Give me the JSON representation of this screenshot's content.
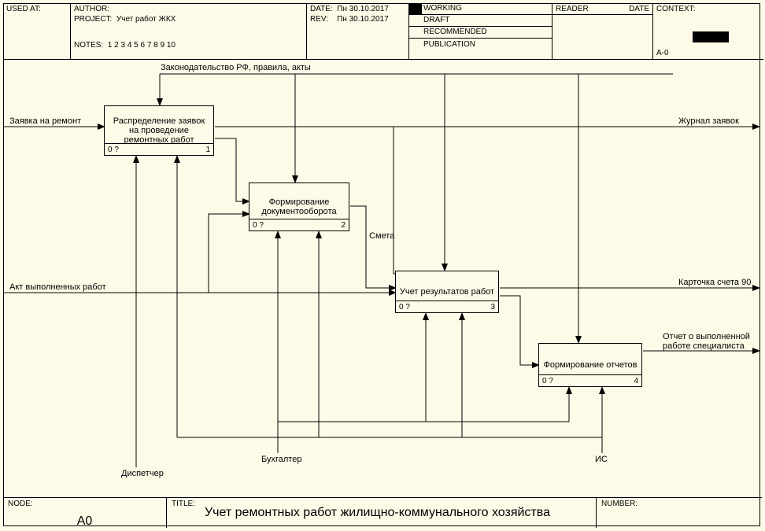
{
  "header": {
    "used_at": "USED AT:",
    "author_label": "AUTHOR:",
    "project_label": "PROJECT:",
    "project_value": "Учет работ ЖКХ",
    "notes_label": "NOTES:",
    "notes_value": "1  2  3  4  5  6  7  8  9  10",
    "date_label": "DATE:",
    "date_value": "Пн 30.10.2017",
    "rev_label": "REV:",
    "rev_value": "Пн 30.10.2017",
    "status": {
      "working": "WORKING",
      "draft": "DRAFT",
      "recommended": "RECOMMENDED",
      "publication": "PUBLICATION"
    },
    "reader_label": "READER",
    "reader_date": "DATE",
    "context_label": "CONTEXT:",
    "context_code": "A-0"
  },
  "nodes": {
    "n1": {
      "title": "Распределение заявок на проведение ремонтных работ",
      "left": "0 ?",
      "right": "1"
    },
    "n2": {
      "title": "Формирование документооборота",
      "left": "0 ?",
      "right": "2"
    },
    "n3": {
      "title": "Учет результатов работ",
      "left": "0 ?",
      "right": "3"
    },
    "n4": {
      "title": "Формирование отчетов",
      "left": "0 ?",
      "right": "4"
    }
  },
  "labels": {
    "input1": "Заявка на ремонт",
    "input2": "Акт выполненных работ",
    "control1": "Законодательство РФ, правила, акты",
    "mech1": "Диспетчер",
    "mech2": "Бухгалтер",
    "mech3": "ИС",
    "flow_smeta": "Смета",
    "out1": "Журнал заявок",
    "out2": "Карточка счета 90",
    "out3a": "Отчет о выполненной",
    "out3b": "работе специалиста"
  },
  "footer": {
    "node_label": "NODE:",
    "node_value": "A0",
    "title_label": "TITLE:",
    "title_value": "Учет ремонтных работ жилищно-коммунального хозяйства",
    "number_label": "NUMBER:"
  }
}
